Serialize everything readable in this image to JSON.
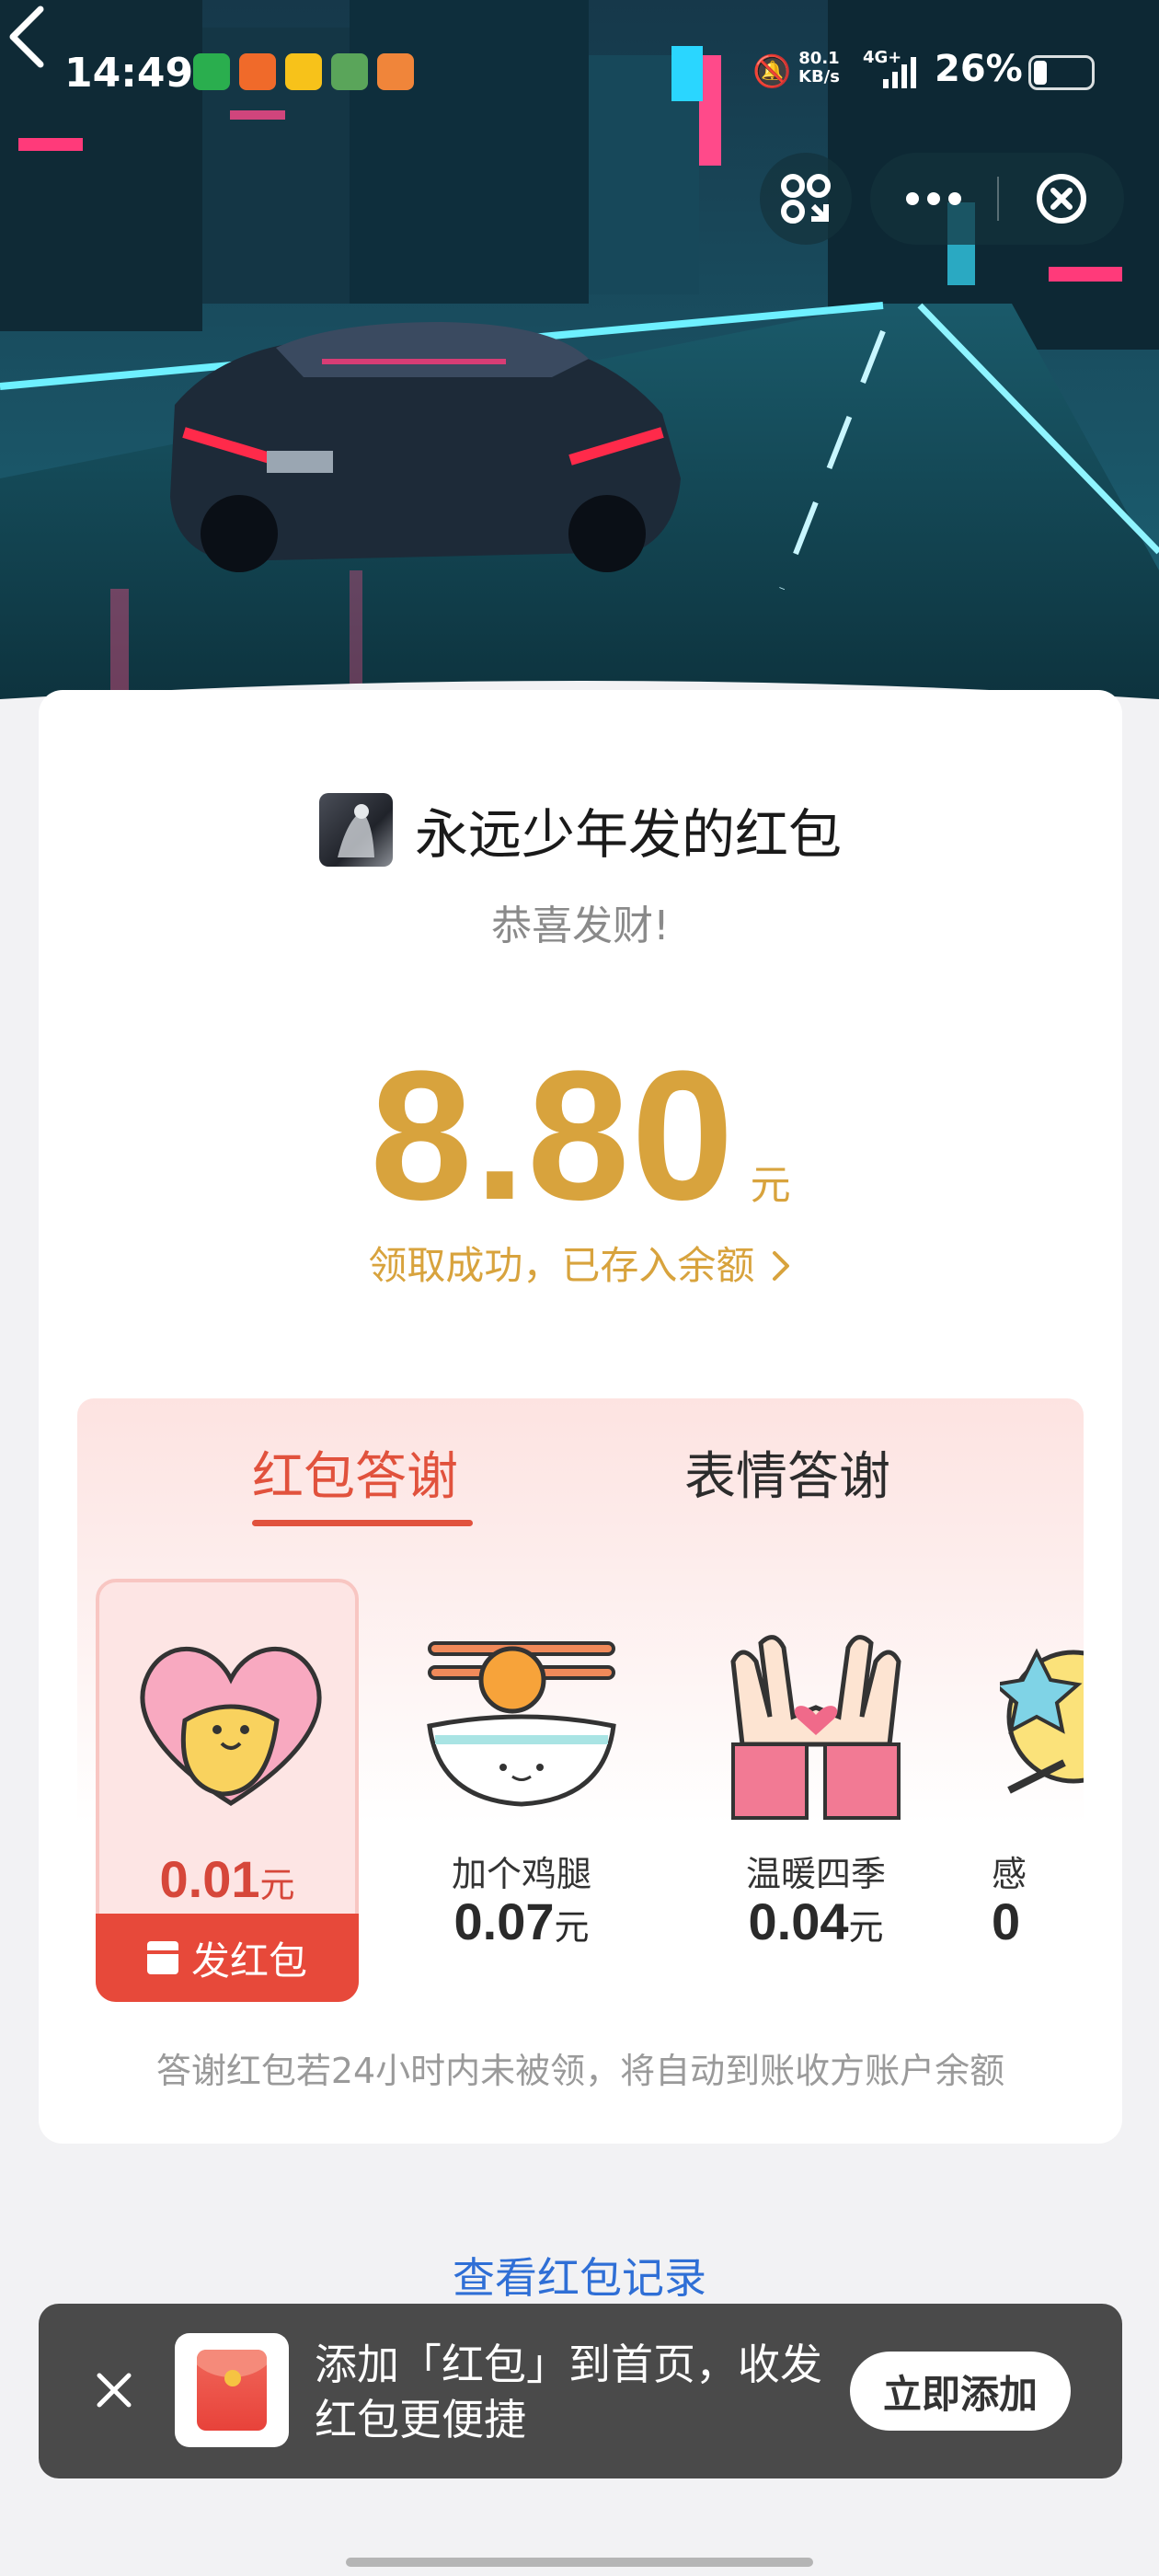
{
  "status_bar": {
    "time": "14:49",
    "net_speed": "80.1",
    "net_unit": "KB/s",
    "signal": "4G+",
    "battery": "26%"
  },
  "card": {
    "sender_name": "永远少年发的红包",
    "greeting": "恭喜发财!",
    "amount": "8.80",
    "amount_unit": "元",
    "status_text": "领取成功，已存入余额"
  },
  "thanks": {
    "tabs": [
      {
        "label": "红包答谢",
        "active": true
      },
      {
        "label": "表情答谢",
        "active": false
      }
    ],
    "items": [
      {
        "label": "",
        "price": "0.01",
        "unit": "元",
        "selected": true,
        "icon": "heart-hug-icon"
      },
      {
        "label": "加个鸡腿",
        "price": "0.07",
        "unit": "元",
        "selected": false,
        "icon": "rice-bowl-drumstick-icon"
      },
      {
        "label": "温暖四季",
        "price": "0.04",
        "unit": "元",
        "selected": false,
        "icon": "heart-hands-icon"
      },
      {
        "label": "感",
        "price": "0",
        "unit": "",
        "selected": false,
        "icon": "star-wand-icon"
      }
    ],
    "send_button": "发红包",
    "note": "答谢红包若24小时内未被领，将自动到账收方账户余额"
  },
  "records_link": "查看红包记录",
  "banner": {
    "text": "添加「红包」到首页，收发红包更便捷",
    "add_button": "立即添加"
  },
  "colors": {
    "gold": "#d8a33d",
    "red": "#e1523d",
    "link_blue": "#2f6fd6"
  }
}
